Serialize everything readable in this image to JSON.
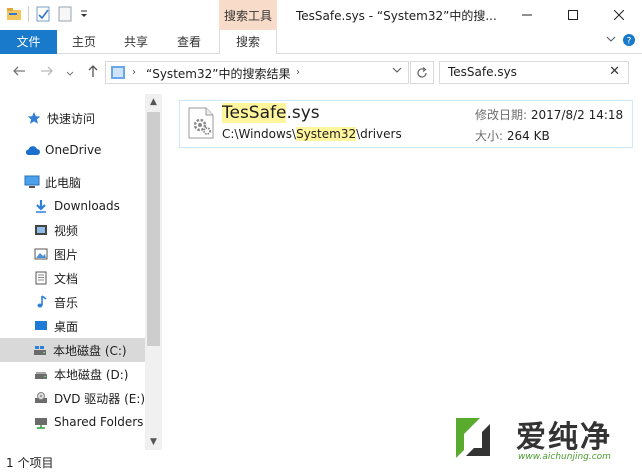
{
  "window": {
    "title": "TesSafe.sys - “System32”中的搜...",
    "contextual_tab_group": "搜索工具"
  },
  "ribbon": {
    "file_tab": "文件",
    "tabs": [
      "主页",
      "共享",
      "查看",
      "搜索"
    ],
    "accent_color": "#1979ca"
  },
  "address": {
    "path": "“System32”中的搜索结果",
    "search_value": "TesSafe.sys"
  },
  "nav_pane": {
    "items": [
      {
        "label": "快速访问",
        "icon": "star-icon"
      },
      {
        "label": "OneDrive",
        "icon": "cloud-icon"
      },
      {
        "label": "此电脑",
        "icon": "computer-icon"
      },
      {
        "label": "Downloads",
        "icon": "download-arrow-icon"
      },
      {
        "label": "视频",
        "icon": "video-icon"
      },
      {
        "label": "图片",
        "icon": "picture-icon"
      },
      {
        "label": "文档",
        "icon": "document-icon"
      },
      {
        "label": "音乐",
        "icon": "music-note-icon"
      },
      {
        "label": "桌面",
        "icon": "desktop-icon"
      },
      {
        "label": "本地磁盘 (C:)",
        "icon": "drive-icon"
      },
      {
        "label": "本地磁盘 (D:)",
        "icon": "drive-icon"
      },
      {
        "label": "DVD 驱动器 (E:)",
        "icon": "dvd-drive-icon"
      },
      {
        "label": "Shared Folders",
        "icon": "network-folder-icon"
      }
    ]
  },
  "result": {
    "name_highlight": "TesSafe",
    "name_rest": ".sys",
    "path_pre": "C:\\Windows\\",
    "path_highlight": "System32",
    "path_post": "\\drivers",
    "modified_label": "修改日期:",
    "modified_value": "2017/8/2 14:18",
    "size_label": "大小:",
    "size_value": "264 KB"
  },
  "status": {
    "count_text": "1 个项目"
  },
  "watermark": {
    "brand": "爱纯净",
    "url": "www.aichunjing.com"
  }
}
